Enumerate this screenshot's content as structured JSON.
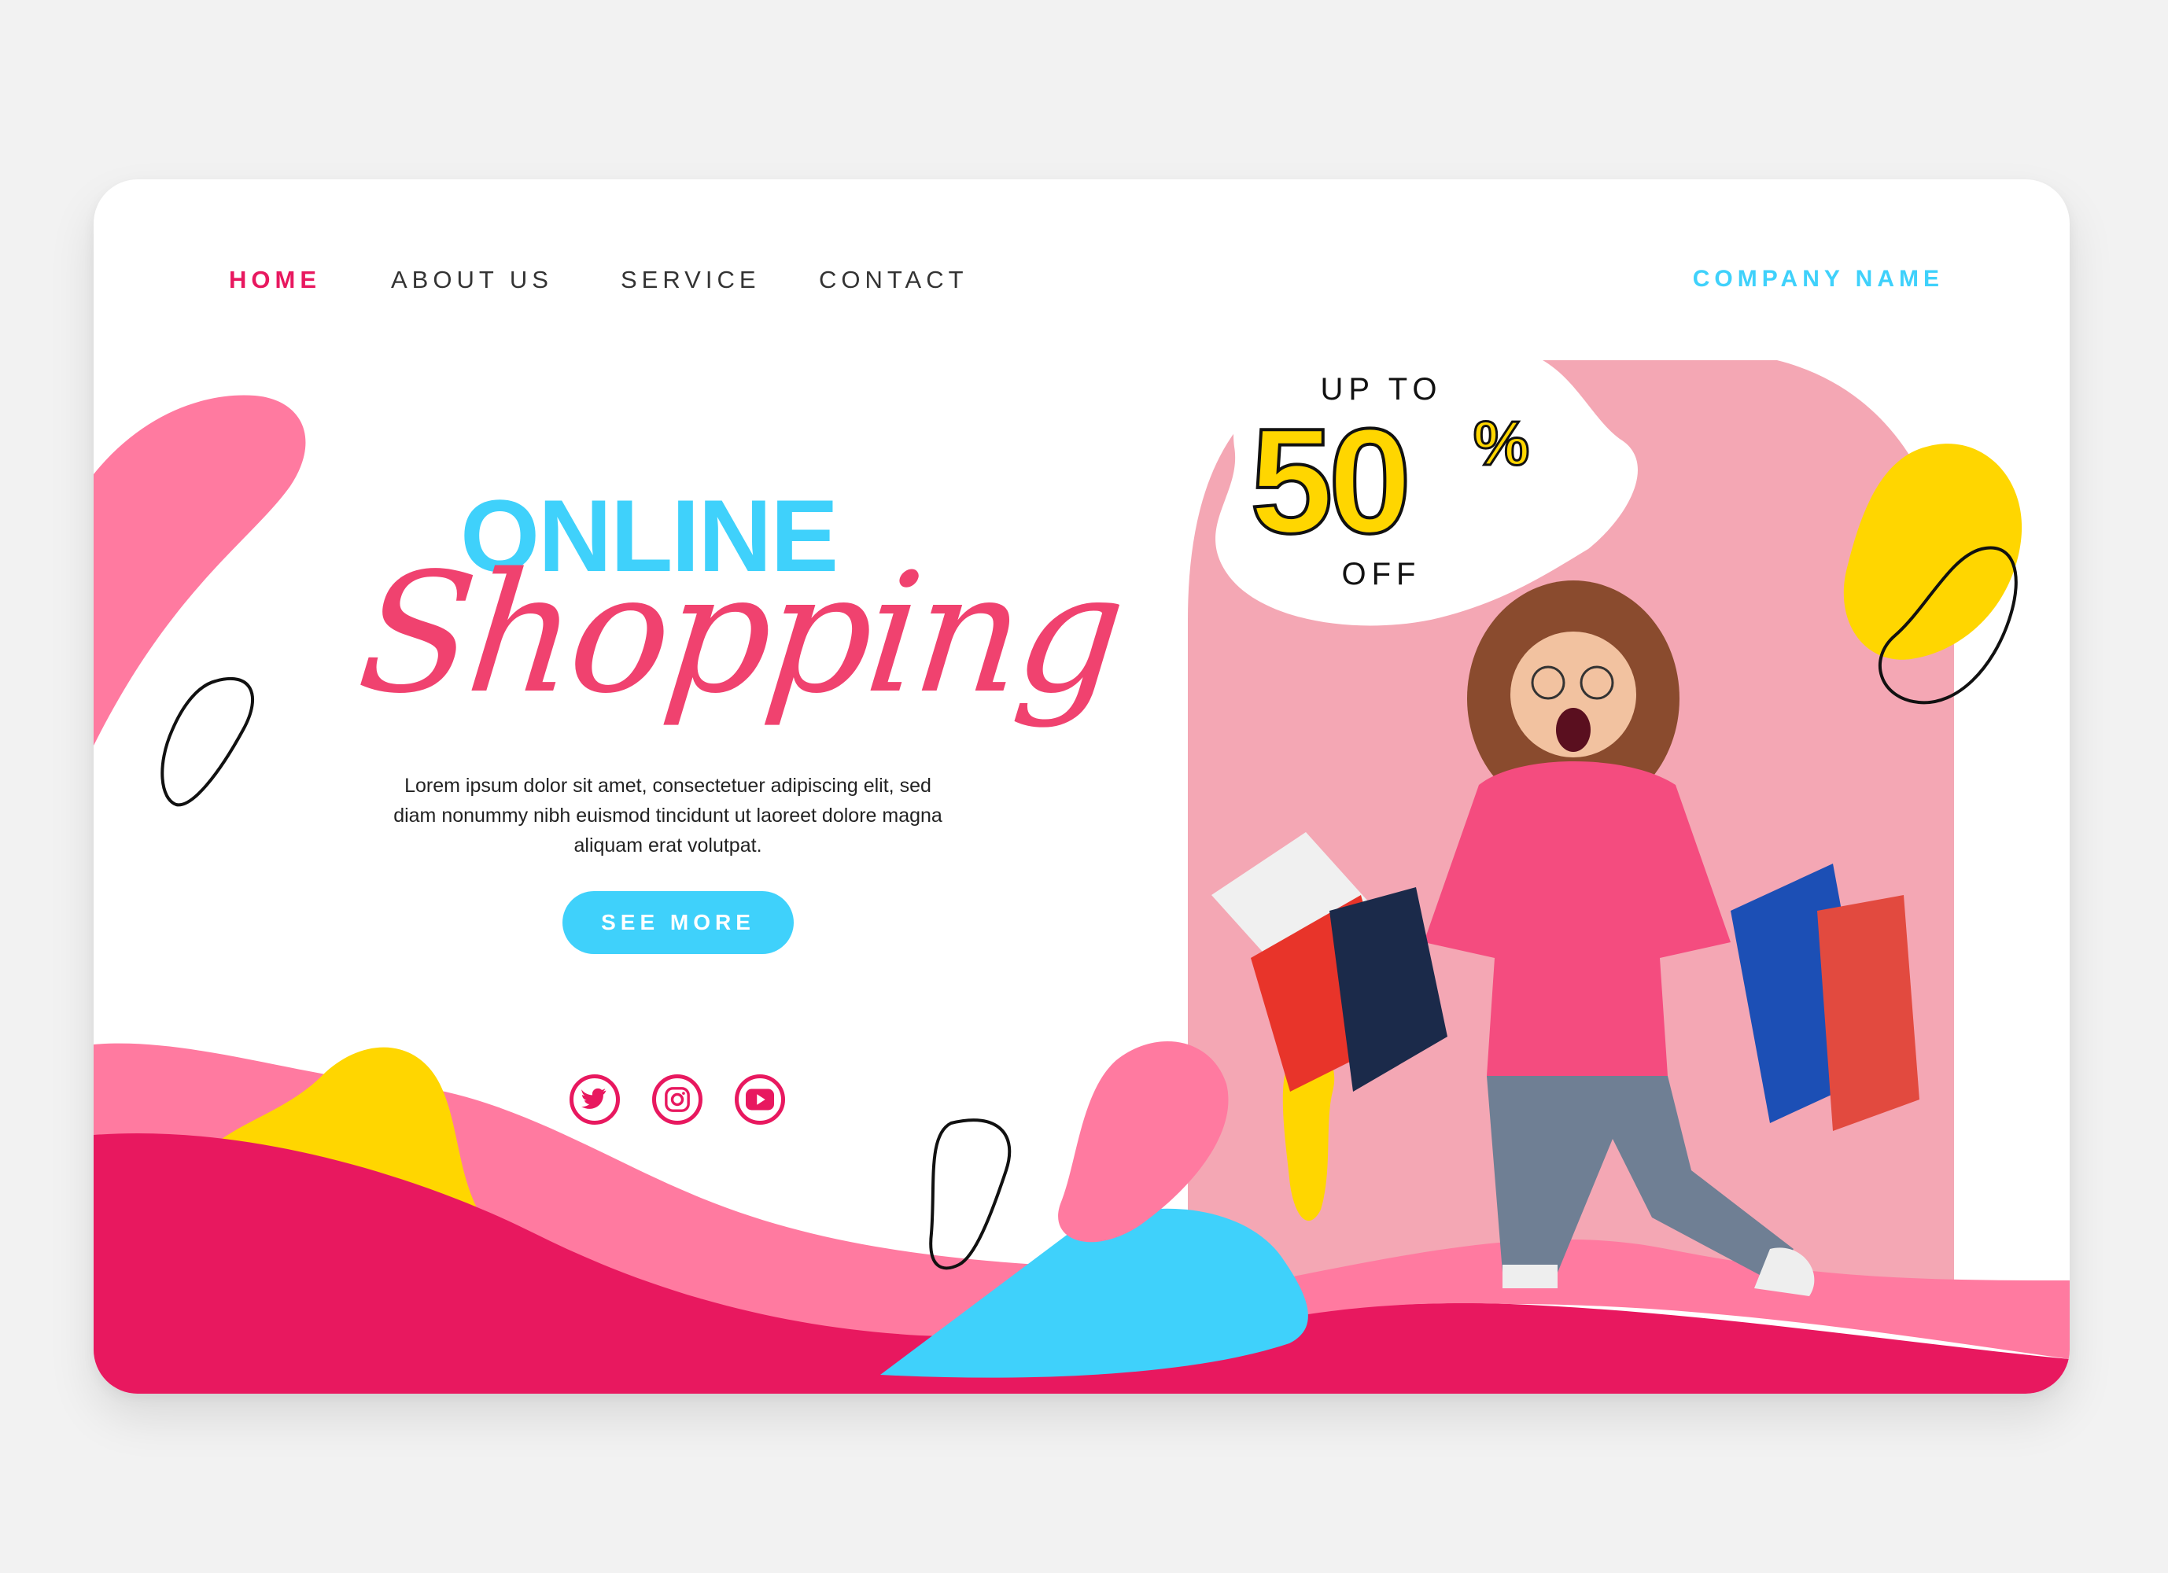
{
  "nav": {
    "items": [
      {
        "label": "HOME",
        "active": true
      },
      {
        "label": "ABOUT US",
        "active": false
      },
      {
        "label": "SERVICE",
        "active": false
      },
      {
        "label": "CONTACT",
        "active": false
      }
    ]
  },
  "company_name": "COMPANY NAME",
  "hero": {
    "title_line1": "ONLINE",
    "title_line2": "Shopping",
    "description": "Lorem ipsum dolor sit amet, consectetuer adipiscing elit, sed diam nonummy nibh euismod tincidunt ut laoreet dolore magna aliquam erat volutpat.",
    "cta_label": "SEE MORE"
  },
  "promo": {
    "line1": "UP TO",
    "amount": "50",
    "percent": "%",
    "line2": "OFF"
  },
  "social": [
    "twitter-icon",
    "instagram-icon",
    "youtube-icon"
  ],
  "colors": {
    "pink": "#f0426f",
    "magenta": "#e8185f",
    "light_pink": "#ff7aa0",
    "cyan": "#3fd1fb",
    "yellow": "#ffd600"
  }
}
